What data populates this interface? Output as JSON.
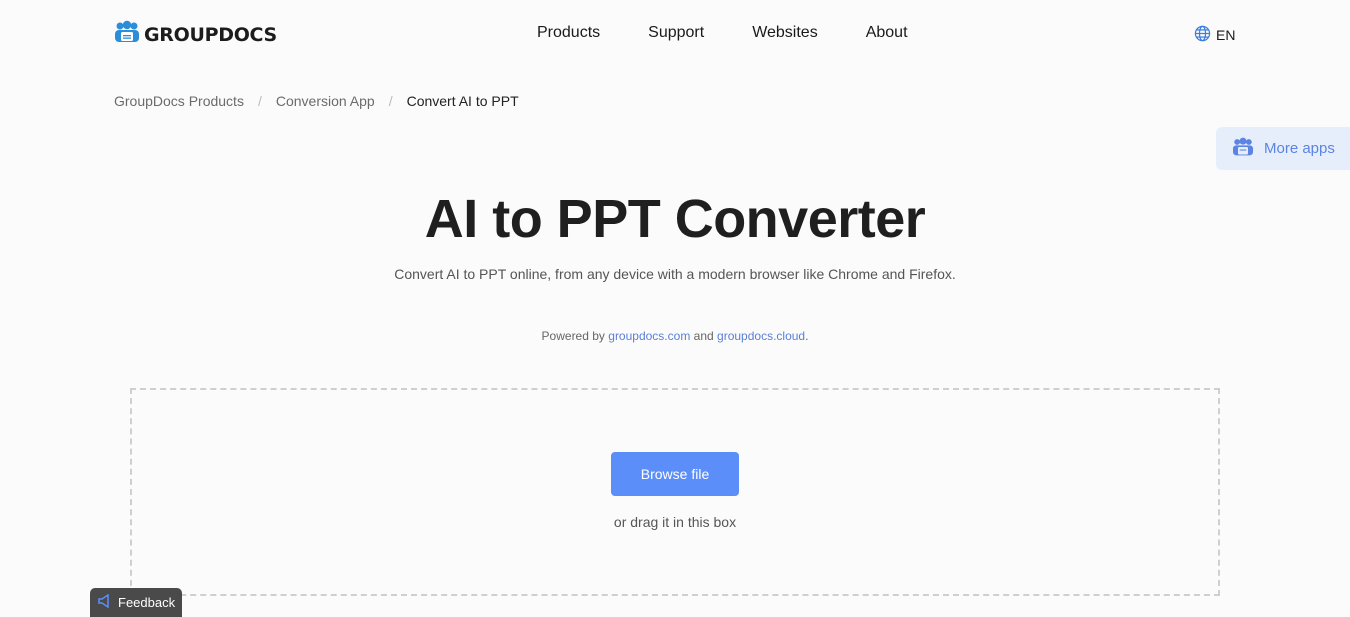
{
  "header": {
    "logo_text": "GROUPDOCS",
    "nav": [
      "Products",
      "Support",
      "Websites",
      "About"
    ],
    "language": "EN",
    "language_icon": "globe-icon"
  },
  "breadcrumb": {
    "items": [
      "GroupDocs Products",
      "Conversion App",
      "Convert AI to PPT"
    ],
    "separator": "/"
  },
  "more_apps": {
    "label": "More apps",
    "icon": "users-icon"
  },
  "main": {
    "title": "AI to PPT Converter",
    "subtitle": "Convert AI to PPT online, from any device with a modern browser like Chrome and Firefox.",
    "powered_prefix": "Powered by",
    "powered_link1": "groupdocs.com",
    "powered_and": "and",
    "powered_link2": "groupdocs.cloud",
    "powered_suffix": "."
  },
  "upload": {
    "browse_label": "Browse file",
    "drag_text": "or drag it in this box"
  },
  "feedback": {
    "label": "Feedback",
    "icon": "megaphone-icon"
  },
  "colors": {
    "accent": "#5b8ef9",
    "link": "#5b7fd6",
    "more_apps_bg": "#e7eefb"
  }
}
